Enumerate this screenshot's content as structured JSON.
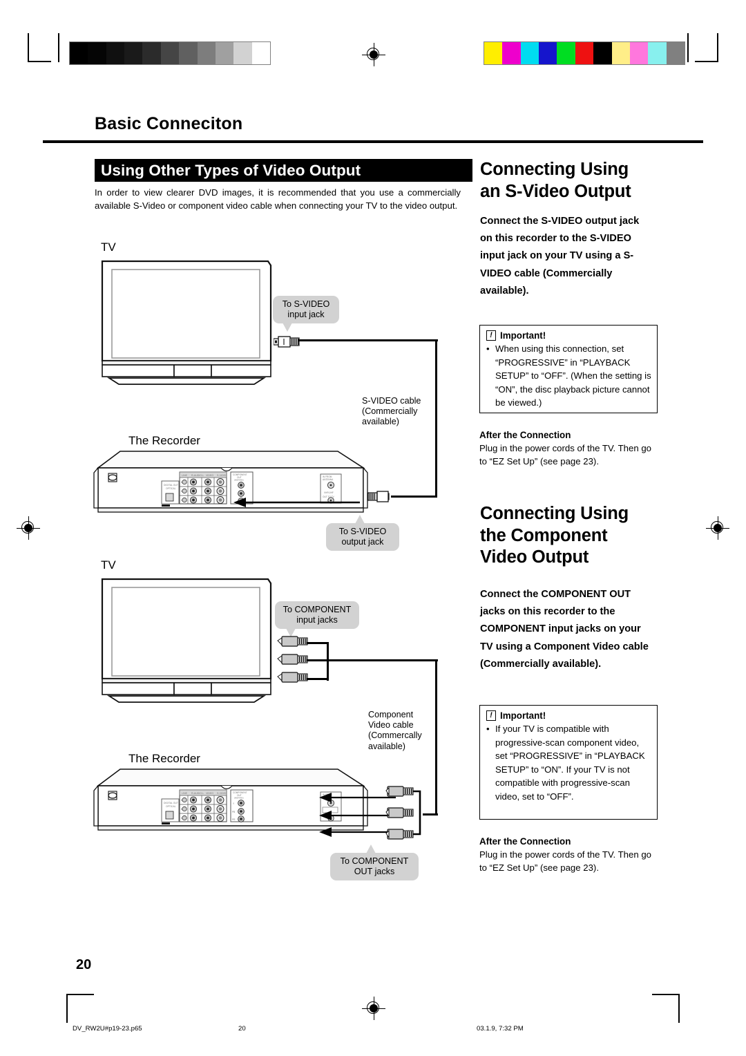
{
  "page": {
    "chapter_title": "Basic Conneciton",
    "page_number": "20"
  },
  "left_column": {
    "section_bar_label": "Using Other Types of Video Output",
    "intro_paragraph": "In order to view clearer DVD images, it is recommended that you use a commercially available S-Video or component video cable when connecting your TV to the video output.",
    "svideo_diagram": {
      "tv_label": "TV",
      "recorder_label": "The Recorder",
      "callout_tv": "To S-VIDEO\ninput jack",
      "callout_tv_line1": "To S-VIDEO",
      "callout_tv_line2": "input jack",
      "cable_label_line1": "S-VIDEO cable",
      "cable_label_line2": "(Commercially",
      "cable_label_line3": "available)",
      "callout_recorder_line1": "To S-VIDEO",
      "callout_recorder_line2": "output jack"
    },
    "component_diagram": {
      "tv_label": "TV",
      "recorder_label": "The Recorder",
      "callout_tv_line1": "To COMPONENT",
      "callout_tv_line2": "input jacks",
      "cable_label_line1": "Component",
      "cable_label_line2": "Video cable",
      "cable_label_line3": "(Commercally",
      "cable_label_line4": "available)",
      "callout_recorder_line1": "To COMPONENT",
      "callout_recorder_line2": "OUT jacks"
    },
    "rear_panel": {
      "digital_out_line1": "DIGITAL OUT",
      "digital_out_line2": "OPTICAL",
      "col_line": "LINE",
      "col_audio": "R-AUDIO-L",
      "col_video": "VIDEO",
      "col_svideo": "S-VIDEO",
      "row_in1": "IN 1",
      "row_in2": "IN 2",
      "row_out": "OUT",
      "component_header_line1": "COMPONENT",
      "component_header_line2": "OUT",
      "component_header_line3": "(480P/480I)",
      "component_y": "Y",
      "component_pb": "PB",
      "component_pr": "PR",
      "antenna_line1": "IN FROM",
      "antenna_line2": "ANTENNA",
      "antenna_line3": "VHF/UHF",
      "out_to_tv": "OUT TO TV"
    }
  },
  "right_column": {
    "svideo_section": {
      "heading_line1": "Connecting Using",
      "heading_line2": "an S-Video Output",
      "lead_paragraph": "Connect the S-VIDEO output jack on this recorder to the S-VIDEO input jack on your TV using a S-VIDEO cable (Commercially available).",
      "important_label": "Important!",
      "important_icon_glyph": "!",
      "important_bullet": "When using this connection, set “PROGRESSIVE” in “PLAYBACK SETUP” to “OFF”. (When the setting is “ON”, the disc playback picture cannot be viewed.)",
      "after_title": "After the Connection",
      "after_text": "Plug in the power cords of the TV. Then go to “EZ Set Up” (see page 23)."
    },
    "component_section": {
      "heading_line1": "Connecting Using",
      "heading_line2": "the Component",
      "heading_line3": "Video Output",
      "lead_paragraph": "Connect the COMPONENT OUT jacks on this recorder to the COMPONENT input jacks on your TV using a Component Video cable (Commercially available).",
      "important_label": "Important!",
      "important_icon_glyph": "!",
      "important_bullet": "If your TV is compatible with progressive-scan component video, set “PROGRESSIVE” in “PLAYBACK SETUP” to “ON”. If your TV is not compatible with progressive-scan video, set to “OFF”.",
      "after_title": "After the Connection",
      "after_text": "Plug in the power cords of the TV. Then go to “EZ Set Up” (see page 23)."
    }
  },
  "footer": {
    "filename": "DV_RW2U#p19-23.p65",
    "page_number": "20",
    "timestamp": "03.1.9, 7:32 PM"
  },
  "print_marks": {
    "grayscale_ramp": [
      "#000000",
      "#050505",
      "#101010",
      "#1a1a1a",
      "#2b2b2b",
      "#454545",
      "#606060",
      "#7d7d7d",
      "#a0a0a0",
      "#d2d2d2",
      "#ffffff"
    ],
    "color_bars": [
      "#ffee00",
      "#ee00cc",
      "#00dcf0",
      "#1515cc",
      "#00dd22",
      "#ee1111",
      "#000000",
      "#ffee88",
      "#ff77dd",
      "#88f0ee",
      "#808080"
    ]
  }
}
